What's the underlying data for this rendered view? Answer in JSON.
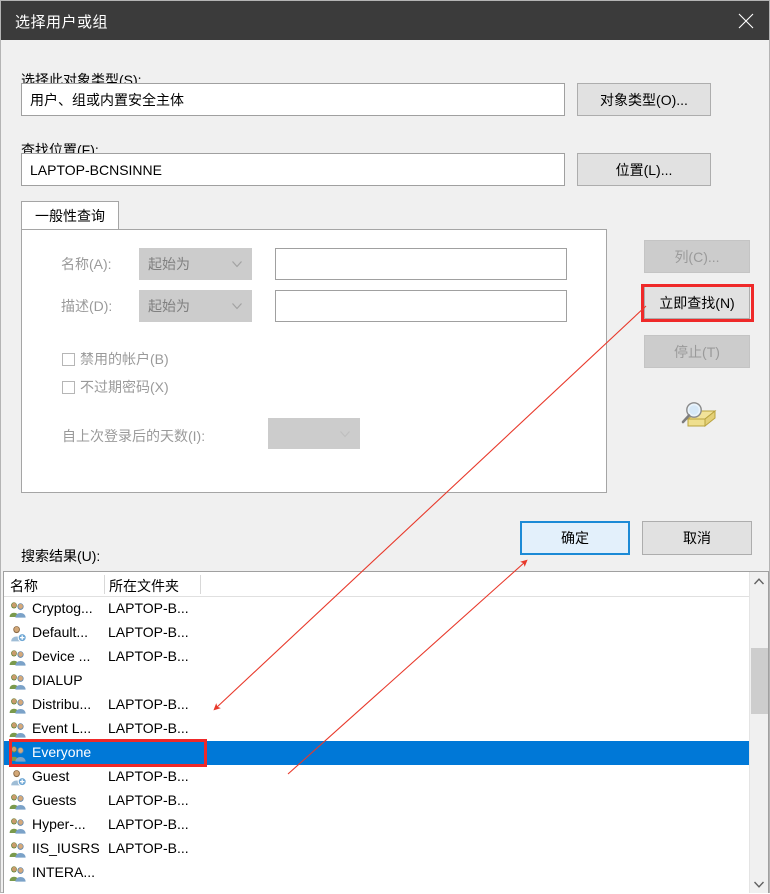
{
  "window": {
    "title": "选择用户或组",
    "close_icon": "close-icon"
  },
  "object_type": {
    "label": "选择此对象类型(S):",
    "value": "用户、组或内置安全主体",
    "button_label": "对象类型(O)..."
  },
  "location": {
    "label": "查找位置(F):",
    "value": "LAPTOP-BCNSINNE",
    "button_label": "位置(L)..."
  },
  "tab": {
    "general_label": "一般性查询"
  },
  "query": {
    "name_label": "名称(A):",
    "name_condition": "起始为",
    "name_value": "",
    "desc_label": "描述(D):",
    "desc_condition": "起始为",
    "desc_value": "",
    "disabled_accounts_label": "禁用的帐户(B)",
    "disabled_accounts_checked": false,
    "no_expire_password_label": "不过期密码(X)",
    "no_expire_password_checked": false,
    "days_since_logon_label": "自上次登录后的天数(I):",
    "days_since_logon_value": ""
  },
  "side_buttons": {
    "columns_label": "列(C)...",
    "columns_disabled": true,
    "find_now_label": "立即查找(N)",
    "find_now_disabled": false,
    "stop_label": "停止(T)",
    "stop_disabled": true,
    "search_icon": "magnifier-folder-icon"
  },
  "dialog_buttons": {
    "ok_label": "确定",
    "cancel_label": "取消"
  },
  "results": {
    "label": "搜索结果(U):",
    "columns": [
      "名称",
      "所在文件夹"
    ],
    "rows": [
      {
        "icon": "group-icon",
        "name": "Cryptog...",
        "folder": "LAPTOP-B...",
        "selected": false
      },
      {
        "icon": "user-icon",
        "name": "Default...",
        "folder": "LAPTOP-B...",
        "selected": false
      },
      {
        "icon": "group-icon",
        "name": "Device ...",
        "folder": "LAPTOP-B...",
        "selected": false
      },
      {
        "icon": "group-icon",
        "name": "DIALUP",
        "folder": "",
        "selected": false
      },
      {
        "icon": "group-icon",
        "name": "Distribu...",
        "folder": "LAPTOP-B...",
        "selected": false
      },
      {
        "icon": "group-icon",
        "name": "Event L...",
        "folder": "LAPTOP-B...",
        "selected": false
      },
      {
        "icon": "group-icon",
        "name": "Everyone",
        "folder": "",
        "selected": true
      },
      {
        "icon": "user-icon",
        "name": "Guest",
        "folder": "LAPTOP-B...",
        "selected": false
      },
      {
        "icon": "group-icon",
        "name": "Guests",
        "folder": "LAPTOP-B...",
        "selected": false
      },
      {
        "icon": "group-icon",
        "name": "Hyper-...",
        "folder": "LAPTOP-B...",
        "selected": false
      },
      {
        "icon": "group-icon",
        "name": "IIS_IUSRS",
        "folder": "LAPTOP-B...",
        "selected": false
      },
      {
        "icon": "group-icon",
        "name": "INTERA...",
        "folder": "",
        "selected": false
      }
    ]
  },
  "scrollbar": {
    "up_icon": "chevron-up-icon",
    "down_icon": "chevron-down-icon"
  },
  "annotations": {
    "highlight_color": "#ef2929",
    "selection_color": "#0078d7",
    "default_button_color": "#1b8ad6"
  }
}
